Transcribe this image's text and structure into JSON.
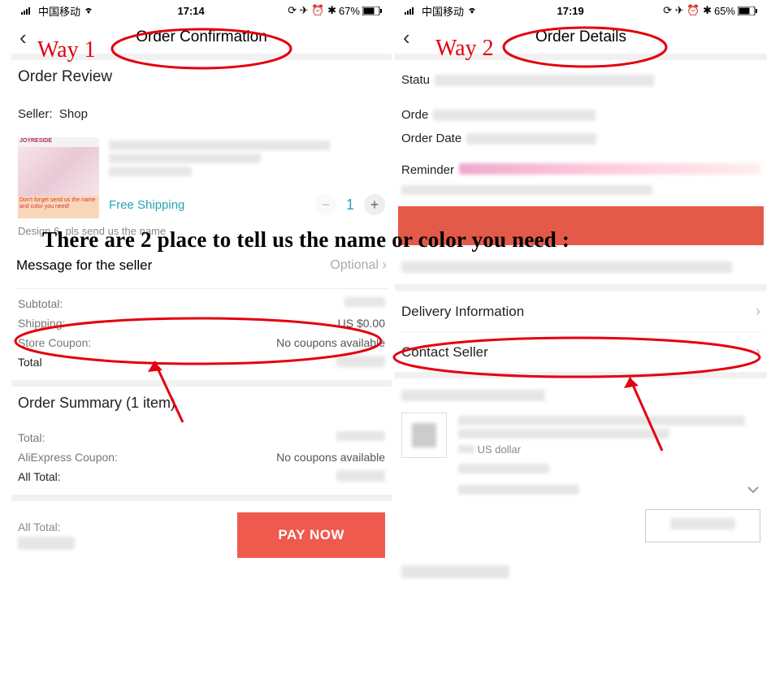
{
  "annotation": {
    "way1": "Way 1",
    "way2": "Way 2",
    "headline": "There are 2 place to tell us the name or color you need :"
  },
  "left": {
    "status": {
      "carrier": "中国移动",
      "time": "17:14",
      "battery": "67%"
    },
    "nav": {
      "title": "Order Confirmation"
    },
    "review_heading": "Order Review",
    "seller_label": "Seller:",
    "seller_name": "Shop",
    "thumb": {
      "brand": "JOYRESIDE",
      "note": "Don't forget send us the name and color you need!"
    },
    "shipping": "Free Shipping",
    "qty": "1",
    "variant_note": "Design 6, pls send us the name",
    "message_label": "Message for the seller",
    "message_placeholder": "Optional",
    "summary": {
      "subtotal_k": "Subtotal:",
      "shipping_k": "Shipping:",
      "shipping_v": "US $0.00",
      "coupon_k": "Store Coupon:",
      "coupon_v": "No coupons available",
      "total_k": "Total"
    },
    "order_summary_heading": "Order Summary (1 item)",
    "os": {
      "total_k": "Total:",
      "ae_coupon_k": "AliExpress Coupon:",
      "ae_coupon_v": "No coupons available",
      "alltotal_k": "All Total:"
    },
    "footer": {
      "alltotal_k": "All Total:",
      "paynow": "PAY NOW"
    }
  },
  "right": {
    "status": {
      "carrier": "中国移动",
      "time": "17:19",
      "battery": "65%"
    },
    "nav": {
      "title": "Order Details"
    },
    "fields": {
      "status": "Statu",
      "order": "Orde",
      "orderdate": "Order Date",
      "reminder": "Reminder"
    },
    "delivery": "Delivery Information",
    "contact": "Contact Seller",
    "currency_hint": "US dollar"
  }
}
